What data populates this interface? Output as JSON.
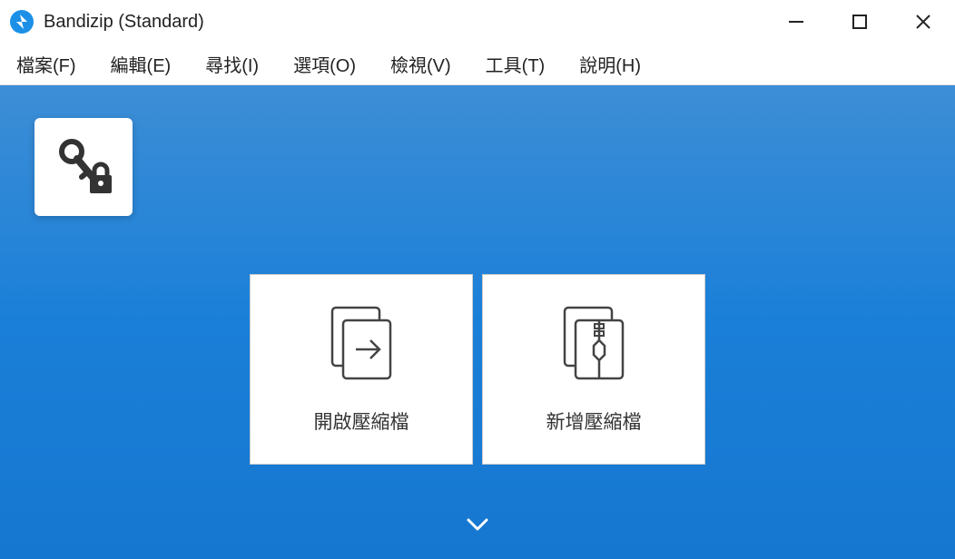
{
  "titlebar": {
    "title": "Bandizip (Standard)"
  },
  "menu": {
    "file": "檔案(F)",
    "edit": "編輯(E)",
    "search": "尋找(I)",
    "options": "選項(O)",
    "view": "檢視(V)",
    "tools": "工具(T)",
    "help": "說明(H)"
  },
  "actions": {
    "open_label": "開啟壓縮檔",
    "new_label": "新增壓縮檔"
  }
}
